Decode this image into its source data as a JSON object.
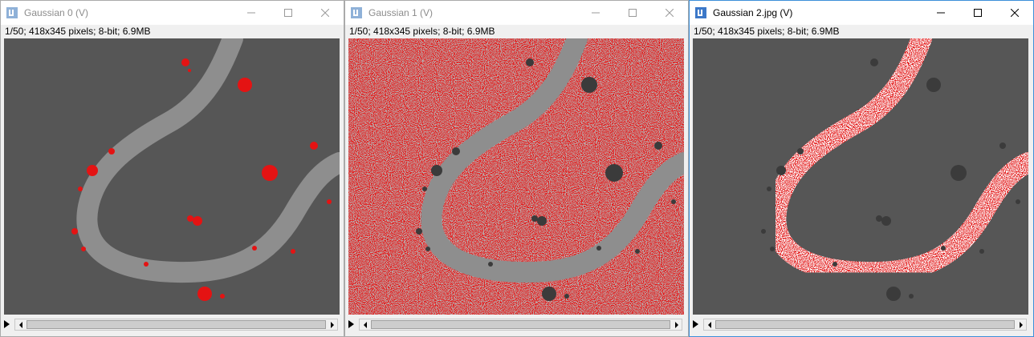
{
  "windows": [
    {
      "title": "Gaussian 0 (V)",
      "info": "1/50; 418x345 pixels; 8-bit; 6.9MB",
      "state": "inactive",
      "overlay": "blobs"
    },
    {
      "title": "Gaussian 1 (V)",
      "info": "1/50; 418x345 pixels; 8-bit; 6.9MB",
      "state": "inactive",
      "overlay": "background"
    },
    {
      "title": "Gaussian 2.jpg (V)",
      "info": "1/50; 418x345 pixels; 8-bit; 6.9MB",
      "state": "active",
      "overlay": "vessel"
    }
  ],
  "colors": {
    "overlay_red": "#e41313",
    "background_gray": "#565656",
    "vessel_gray": "#8e8e8e",
    "blob_gray": "#3b3b3b",
    "active_border": "#3c8fd9"
  },
  "icons": {
    "app": "imagej-icon",
    "minimize": "minimize-icon",
    "maximize": "maximize-icon",
    "close": "close-icon",
    "play": "play-icon",
    "scroll_left": "scroll-left-icon",
    "scroll_right": "scroll-right-icon"
  }
}
